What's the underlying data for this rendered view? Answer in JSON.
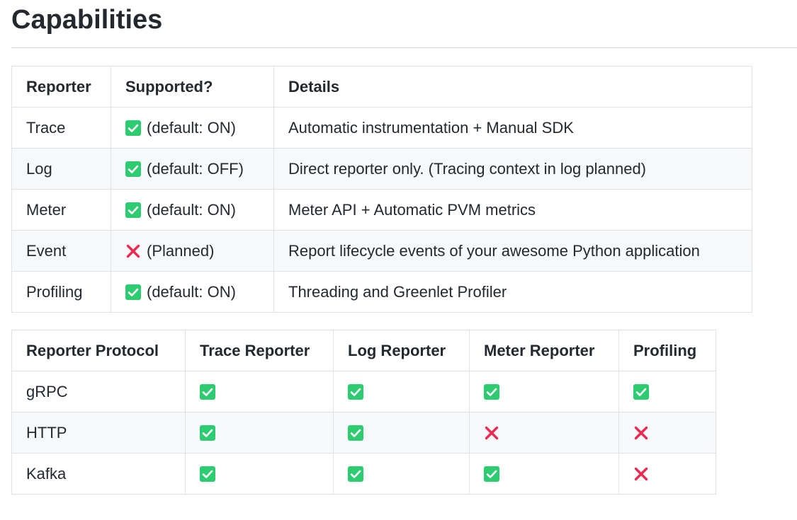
{
  "page": {
    "title": "Capabilities"
  },
  "colors": {
    "check_green": "#2ecc71",
    "cross_red": "#f0274f",
    "border": "#dfe2e5",
    "alt_row": "#f6f8fa",
    "text": "#24292f"
  },
  "capabilities": {
    "headers": [
      "Reporter",
      "Supported?",
      "Details"
    ],
    "rows": [
      {
        "reporter": "Trace",
        "icon": "check",
        "status": "(default: ON)",
        "details": "Automatic instrumentation + Manual SDK"
      },
      {
        "reporter": "Log",
        "icon": "check",
        "status": "(default: OFF)",
        "details": "Direct reporter only. (Tracing context in log planned)"
      },
      {
        "reporter": "Meter",
        "icon": "check",
        "status": "(default: ON)",
        "details": "Meter API + Automatic PVM metrics"
      },
      {
        "reporter": "Event",
        "icon": "cross",
        "status": "(Planned)",
        "details": "Report lifecycle events of your awesome Python application"
      },
      {
        "reporter": "Profiling",
        "icon": "check",
        "status": "(default: ON)",
        "details": "Threading and Greenlet Profiler"
      }
    ]
  },
  "protocols": {
    "headers": [
      "Reporter Protocol",
      "Trace Reporter",
      "Log Reporter",
      "Meter Reporter",
      "Profiling"
    ],
    "rows": [
      {
        "protocol": "gRPC",
        "cells": [
          "check",
          "check",
          "check",
          "check"
        ]
      },
      {
        "protocol": "HTTP",
        "cells": [
          "check",
          "check",
          "cross",
          "cross"
        ]
      },
      {
        "protocol": "Kafka",
        "cells": [
          "check",
          "check",
          "check",
          "cross"
        ]
      }
    ]
  }
}
